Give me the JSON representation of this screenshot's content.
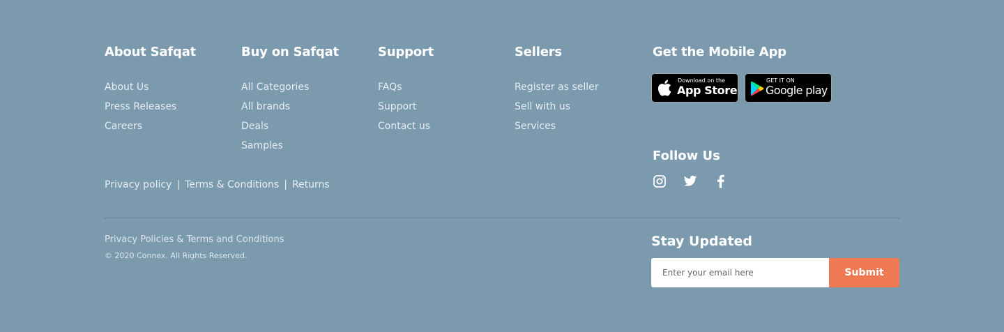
{
  "columns": [
    {
      "title": "About Safqat",
      "links": [
        "About Us",
        "Press Releases",
        "Careers"
      ]
    },
    {
      "title": "Buy on Safqat",
      "links": [
        "All Categories",
        "All brands",
        "Deals",
        "Samples"
      ]
    },
    {
      "title": "Support",
      "links": [
        "FAQs",
        "Support",
        "Contact us"
      ]
    },
    {
      "title": "Sellers",
      "links": [
        "Register as seller",
        "Sell with us",
        "Services"
      ]
    }
  ],
  "legal": {
    "privacy": "Privacy policy",
    "terms": "Terms & Conditions",
    "returns": "Returns",
    "separator": "|"
  },
  "mobile_app": {
    "title": "Get the Mobile App",
    "app_store": {
      "small": "Download on the",
      "big": "App Store",
      "icon": "apple-icon"
    },
    "google_play": {
      "small": "GET IT ON",
      "big": "Google play",
      "icon": "google-play-icon"
    }
  },
  "follow": {
    "title": "Follow Us",
    "icons": [
      "instagram-icon",
      "twitter-icon",
      "facebook-icon"
    ]
  },
  "bottom": {
    "policies": "Privacy Policies & Terms and Conditions",
    "copyright": "© 2020 Connex. All Rights Reserved."
  },
  "newsletter": {
    "title": "Stay Updated",
    "placeholder": "Enter your email here",
    "value": "",
    "submit_label": "Submit"
  },
  "colors": {
    "background": "#7b9aae",
    "accent": "#ef7a52",
    "text": "#ffffff"
  }
}
